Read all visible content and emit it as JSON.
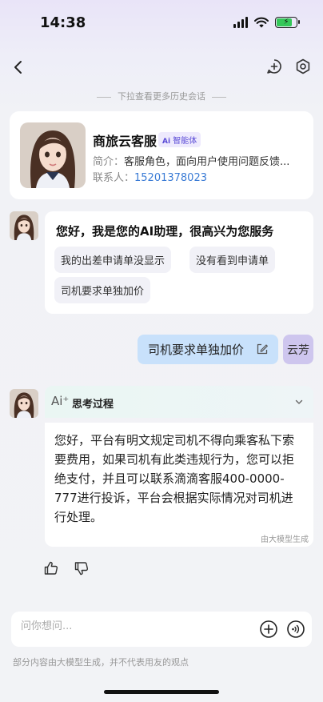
{
  "status_bar": {
    "time": "14:38"
  },
  "history_hint": "下拉查看更多历史会话",
  "profile": {
    "name": "商旅云客服",
    "badge": "智能体",
    "intro_key": "简介：",
    "intro_value": "客服角色，面向用户使用问题反馈...",
    "contact_key": "联系人：",
    "contact_value": "15201378023"
  },
  "greeting": {
    "text": "您好，我是您的AI助理，很高兴为您服务",
    "chips": [
      "我的出差申请单没显示",
      "没有看到申请单",
      "司机要求单独加价"
    ]
  },
  "user_message": {
    "text": "司机要求单独加价",
    "sender": "云芳"
  },
  "thinking": {
    "label": "思考过程"
  },
  "answer": {
    "text": "您好，平台有明文规定司机不得向乘客私下索要费用，如果司机有此类违规行为，您可以拒绝支付，并且可以联系滴滴客服400-0000-777进行投诉，平台会根据实际情况对司机进行处理。",
    "note": "由大模型生成"
  },
  "input": {
    "placeholder": "问你想问..."
  },
  "disclaimer": "部分内容由大模型生成，并不代表用友的观点",
  "colors": {
    "accent": "#5a4bd6",
    "user_bubble": "#c8e1fb",
    "user_tag": "#cec6ee"
  },
  "icons": [
    "back-icon",
    "add-chat-icon",
    "settings-icon",
    "edit-icon",
    "chevron-down-icon",
    "thumbs-up-icon",
    "thumbs-down-icon",
    "plus-icon",
    "voice-icon"
  ]
}
